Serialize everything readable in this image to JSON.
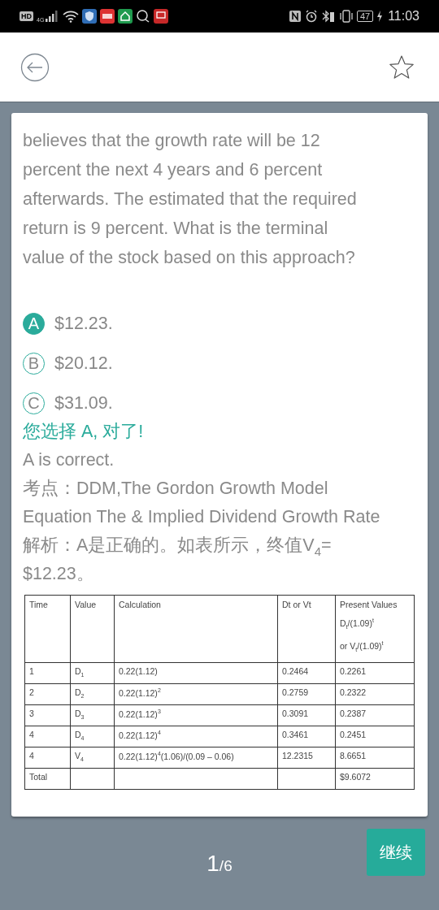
{
  "status_bar": {
    "network_labels": [
      "HD",
      "4G"
    ],
    "battery": "47",
    "time": "11:03"
  },
  "question": {
    "text": "believes that the growth rate will be 12 percent the next 4 years and 6 percent afterwards. The estimated that the required return is 9 percent. What is the terminal value of the stock based on this approach?"
  },
  "options": [
    {
      "letter": "A",
      "text": "$12.23.",
      "selected": true
    },
    {
      "letter": "B",
      "text": "$20.12.",
      "selected": false
    },
    {
      "letter": "C",
      "text": "$31.09.",
      "selected": false
    }
  ],
  "explanation": [
    {
      "kind": "verdict",
      "text": "您选择 A, 对了!"
    },
    {
      "kind": "plain",
      "text": "A is correct."
    },
    {
      "kind": "plain",
      "text": "考点：DDM,The Gordon Growth Model Equation The & Implied Dividend Growth Rate"
    },
    {
      "kind": "plain",
      "text": "解析：A是正确的。如表所示，终值V$_{4}$= $12.23。"
    }
  ],
  "table": {
    "columns": [
      "Time",
      "Value",
      "Calculation",
      "Dt or Vt",
      "Present Values\nD$_{t}$/(1.09)$^{t}$\nor V$_{t}$/(1.09)$^{t}$"
    ],
    "rows": [
      [
        "1",
        "D$_{1}$",
        "0.22(1.12)",
        "0.2464",
        "0.2261"
      ],
      [
        "2",
        "D$_{2}$",
        "0.22(1.12)$^{2}$",
        "0.2759",
        "0.2322"
      ],
      [
        "3",
        "D$_{3}$",
        "0.22(1.12)$^{3}$",
        "0.3091",
        "0.2387"
      ],
      [
        "4",
        "D$_{4}$",
        "0.22(1.12)$^{4}$",
        "0.3461",
        "0.2451"
      ],
      [
        "4",
        "V$_{4}$",
        "0.22(1.12)$^{4}$(1.06)/(0.09 – 0.06)",
        "12.2315",
        "8.6651"
      ],
      [
        "Total",
        "",
        "",
        "",
        "$9.6072"
      ]
    ]
  },
  "pager": {
    "current": "1",
    "total": "/6"
  },
  "continue_button": "继续"
}
